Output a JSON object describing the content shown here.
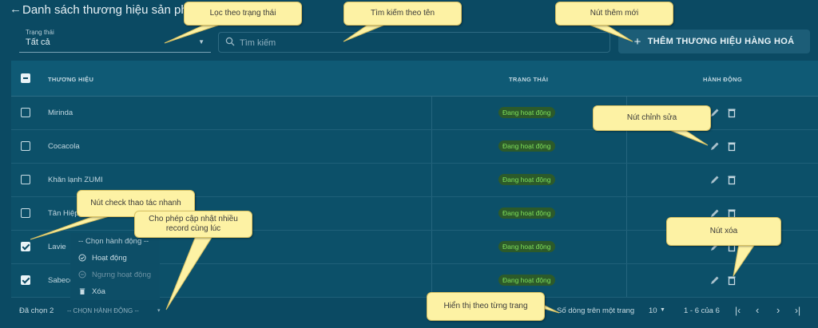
{
  "header": {
    "title": "Danh sách thương hiệu sản phẩm"
  },
  "filter": {
    "status_label": "Trạng thái",
    "status_value": "Tất cả"
  },
  "search": {
    "placeholder": "Tìm kiếm"
  },
  "toolbar": {
    "add_label": "THÊM THƯƠNG HIỆU HÀNG HOÁ"
  },
  "table": {
    "columns": [
      "THƯƠNG HIỆU",
      "TRẠNG THÁI",
      "HÀNH ĐỘNG"
    ],
    "rows": [
      {
        "name": "Mirinda",
        "status": "Đang hoạt động",
        "checked": false
      },
      {
        "name": "Cocacola",
        "status": "Đang hoạt động",
        "checked": false
      },
      {
        "name": "Khăn lạnh ZUMI",
        "status": "Đang hoạt động",
        "checked": false
      },
      {
        "name": "Tân Hiệp",
        "status": "Đang hoạt động",
        "checked": false
      },
      {
        "name": "Lavie",
        "status": "Đang hoạt động",
        "checked": true
      },
      {
        "name": "Sabeco",
        "status": "Đang hoạt động",
        "checked": true
      }
    ]
  },
  "bulk_menu": {
    "placeholder": "-- Chọn hành động --",
    "items": [
      {
        "label": "Hoạt động",
        "icon": "check-circle-icon",
        "disabled": false
      },
      {
        "label": "Ngưng hoạt động",
        "icon": "minus-circle-icon",
        "disabled": true
      },
      {
        "label": "Xóa",
        "icon": "trash-icon",
        "disabled": false
      }
    ]
  },
  "footer": {
    "selected": "Đã chọn 2",
    "action_select": "-- CHỌN HÀNH ĐỘNG --",
    "rows_per_page_label": "Số dòng trên một trang",
    "rows_per_page": "10",
    "range": "1 - 6 của 6"
  },
  "callouts": {
    "filter": "Lọc theo trạng thái",
    "search": "Tìm kiếm theo tên",
    "add": "Nút thêm mới",
    "edit": "Nút chỉnh sửa",
    "check": "Nút check thao tác nhanh",
    "bulk": "Cho phép cập nhật nhiều record cùng lúc",
    "delete": "Nút xóa",
    "pagination": "Hiển thị theo từng trang"
  },
  "colors": {
    "background": "#0b4a63",
    "table_header": "#0f5a75",
    "status_badge_bg": "#2c5a2a",
    "status_badge_text": "#7fe05a",
    "callout": "#fdf2a4"
  }
}
